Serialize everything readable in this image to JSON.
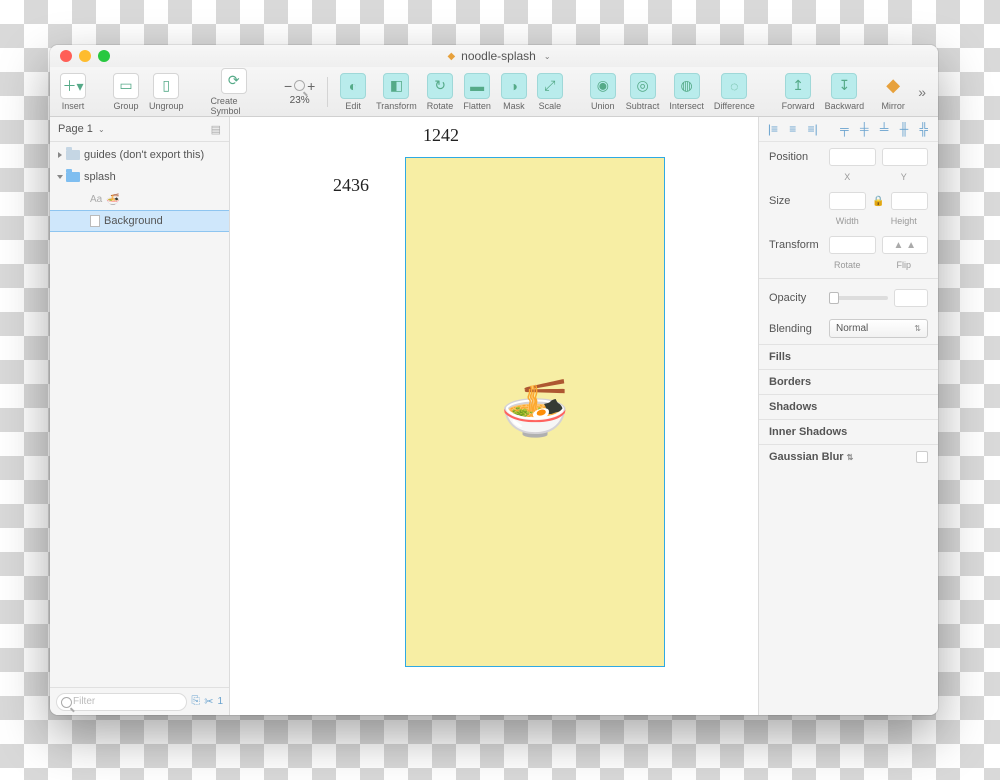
{
  "title": {
    "filename": "noodle-splash",
    "dropdown_glyph": "⌄"
  },
  "toolbar": {
    "insert": "Insert",
    "group": "Group",
    "ungroup": "Ungroup",
    "create_symbol": "Create Symbol",
    "zoom_minus": "−",
    "zoom_plus": "+",
    "zoom_value": "23%",
    "edit": "Edit",
    "transform": "Transform",
    "rotate": "Rotate",
    "flatten": "Flatten",
    "mask": "Mask",
    "scale": "Scale",
    "union": "Union",
    "subtract": "Subtract",
    "intersect": "Intersect",
    "difference": "Difference",
    "forward": "Forward",
    "backward": "Backward",
    "mirror": "Mirror"
  },
  "sidebar": {
    "page_label": "Page 1",
    "items": [
      {
        "label": "guides (don't export this)"
      },
      {
        "label": "splash"
      },
      {
        "label": "🍜"
      },
      {
        "label": "Background"
      }
    ],
    "text_prefix": "Aa",
    "filter_placeholder": "Filter",
    "footer_count": "1"
  },
  "canvas": {
    "width_label": "1242",
    "height_label": "2436"
  },
  "inspector": {
    "position_label": "Position",
    "x_label": "X",
    "y_label": "Y",
    "size_label": "Size",
    "width_label": "Width",
    "height_label": "Height",
    "transform_label": "Transform",
    "rotate_label": "Rotate",
    "flip_label": "Flip",
    "opacity_label": "Opacity",
    "blending_label": "Blending",
    "blending_value": "Normal",
    "fills": "Fills",
    "borders": "Borders",
    "shadows": "Shadows",
    "inner_shadows": "Inner Shadows",
    "gaussian_blur": "Gaussian Blur"
  }
}
